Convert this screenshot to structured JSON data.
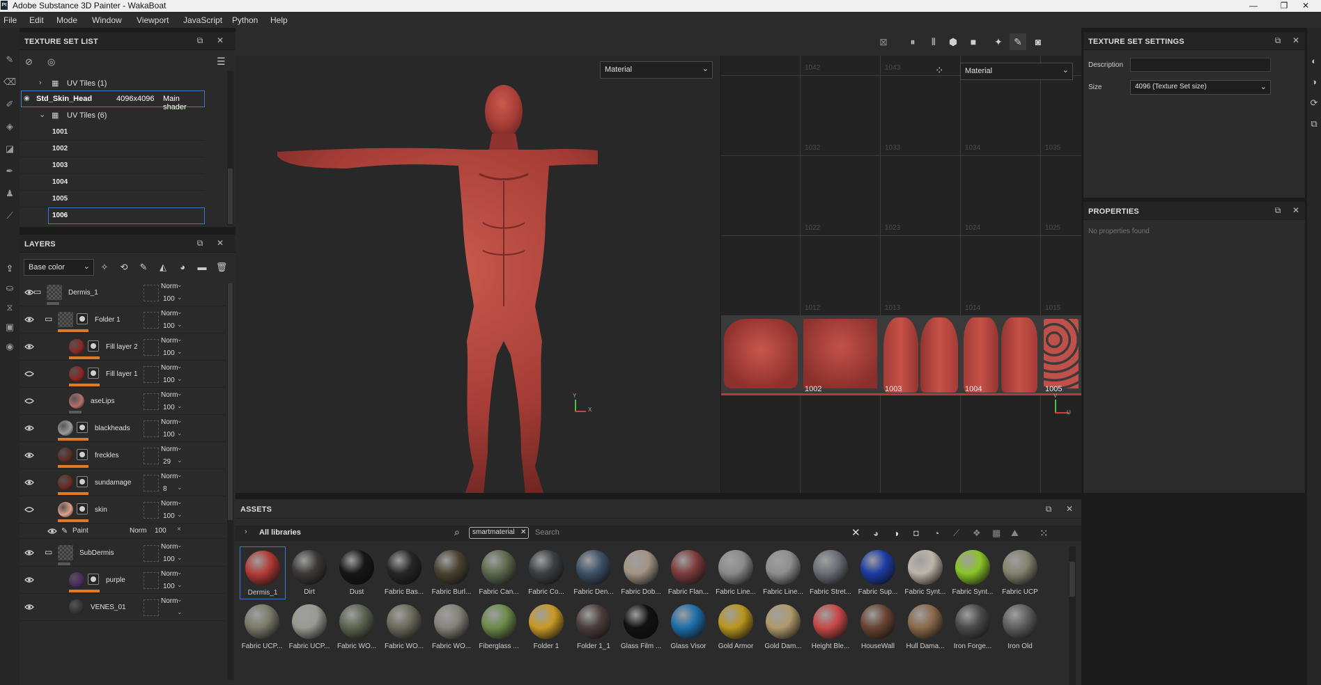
{
  "window": {
    "app_badge": "Pt",
    "title": "Adobe Substance 3D Painter - WakaBoat",
    "minimize": "—",
    "maximize": "❐",
    "close": "✕"
  },
  "menu": [
    "File",
    "Edit",
    "Mode",
    "Window",
    "Viewport",
    "JavaScript",
    "Python",
    "Help"
  ],
  "texture_set_list": {
    "title": "TEXTURE SET LIST",
    "uv_tiles_collapsed": "UV Tiles (1)",
    "texture_set": {
      "name": "Std_Skin_Head",
      "resolution": "4096x4096",
      "shader": "Main shader"
    },
    "uv_tiles_expanded": "UV Tiles (6)",
    "tiles": [
      "1001",
      "1002",
      "1003",
      "1004",
      "1005",
      "1006"
    ],
    "selected_tile": "1006"
  },
  "layers": {
    "title": "LAYERS",
    "channel": "Base color",
    "items": [
      {
        "name": "Dermis_1",
        "blend": "Norm",
        "opacity": "100"
      },
      {
        "name": "Folder 1",
        "blend": "Norm",
        "opacity": "100"
      },
      {
        "name": "Fill layer 2",
        "blend": "Norm",
        "opacity": "100"
      },
      {
        "name": "Fill layer 1",
        "blend": "Norm",
        "opacity": "100"
      },
      {
        "name": "aseLips",
        "blend": "Norm",
        "opacity": "100"
      },
      {
        "name": "blackheads",
        "blend": "Norm",
        "opacity": "100"
      },
      {
        "name": "freckles",
        "blend": "Norm",
        "opacity": "29"
      },
      {
        "name": "sundamage",
        "blend": "Norm",
        "opacity": "8"
      },
      {
        "name": "skin",
        "blend": "Norm",
        "opacity": "100"
      },
      {
        "name": "SubDermis",
        "blend": "Norm",
        "opacity": "100"
      },
      {
        "name": "purple",
        "blend": "Norm",
        "opacity": "100"
      },
      {
        "name": "VENES_01",
        "blend": "Norm",
        "opacity": ""
      }
    ],
    "paint_effect": {
      "name": "Paint",
      "blend": "Norm",
      "opacity": "100"
    }
  },
  "viewport": {
    "material_3d": "Material",
    "material_2d": "Material",
    "grid_labels": [
      "1042",
      "1043",
      "1032",
      "1033",
      "1034",
      "1035",
      "1022",
      "1023",
      "1024",
      "1025",
      "1012",
      "1013",
      "1014",
      "1015"
    ],
    "uv_tiles": [
      "1002",
      "1003",
      "1004",
      "1005"
    ],
    "axis_3d": {
      "y": "Y",
      "x": "X"
    },
    "axis_2d": {
      "v": "V",
      "u": "U"
    }
  },
  "texture_set_settings": {
    "title": "TEXTURE SET SETTINGS",
    "description_label": "Description",
    "description_value": "",
    "size_label": "Size",
    "size_value": "4096 (Texture Set size)"
  },
  "properties": {
    "title": "PROPERTIES",
    "empty": "No properties found"
  },
  "assets": {
    "title": "ASSETS",
    "library": "All libraries",
    "filter_tag": "smartmaterial",
    "search_placeholder": "Search",
    "row1": [
      {
        "name": "Dermis_1",
        "color": "#b23a36"
      },
      {
        "name": "Dirt",
        "color": "#3c3a38"
      },
      {
        "name": "Dust",
        "color": "#161616"
      },
      {
        "name": "Fabric Bas...",
        "color": "#262626"
      },
      {
        "name": "Fabric Burl...",
        "color": "#4a4232"
      },
      {
        "name": "Fabric Can...",
        "color": "#5d6a4c"
      },
      {
        "name": "Fabric Co...",
        "color": "#3b3f44"
      },
      {
        "name": "Fabric Den...",
        "color": "#3d5066"
      },
      {
        "name": "Fabric Dob...",
        "color": "#a49484"
      },
      {
        "name": "Fabric Flan...",
        "color": "#7e3c3c"
      },
      {
        "name": "Fabric Line...",
        "color": "#8a8a8a"
      },
      {
        "name": "Fabric Line...",
        "color": "#8e8e8e"
      },
      {
        "name": "Fabric Stret...",
        "color": "#6a6f76"
      },
      {
        "name": "Fabric Sup...",
        "color": "#1c3ca6"
      },
      {
        "name": "Fabric Synt...",
        "color": "#bdb5a8"
      },
      {
        "name": "Fabric Synt...",
        "color": "#8ac42a"
      },
      {
        "name": "Fabric UCP",
        "color": "#85826e"
      }
    ],
    "row2": [
      {
        "name": "Fabric UCP...",
        "color": "#7a7a6a"
      },
      {
        "name": "Fabric UCP...",
        "color": "#9a9a92"
      },
      {
        "name": "Fabric WO...",
        "color": "#5b6450"
      },
      {
        "name": "Fabric WO...",
        "color": "#6c6a5a"
      },
      {
        "name": "Fabric WO...",
        "color": "#858278"
      },
      {
        "name": "Fiberglass ...",
        "color": "#6e8a4a"
      },
      {
        "name": "Folder 1",
        "color": "#c99a24"
      },
      {
        "name": "Folder 1_1",
        "color": "#4a3e3a"
      },
      {
        "name": "Glass Film ...",
        "color": "#111111"
      },
      {
        "name": "Glass Visor",
        "color": "#1d6ea8"
      },
      {
        "name": "Gold Armor",
        "color": "#b8961e"
      },
      {
        "name": "Gold Dam...",
        "color": "#b09a6c"
      },
      {
        "name": "Height Ble...",
        "color": "#c84848"
      },
      {
        "name": "HouseWall",
        "color": "#6a4432"
      },
      {
        "name": "Hull Dama...",
        "color": "#8a6a4a"
      },
      {
        "name": "Iron Forge...",
        "color": "#4a4a4a"
      },
      {
        "name": "Iron Old",
        "color": "#5e5e5e"
      }
    ]
  }
}
